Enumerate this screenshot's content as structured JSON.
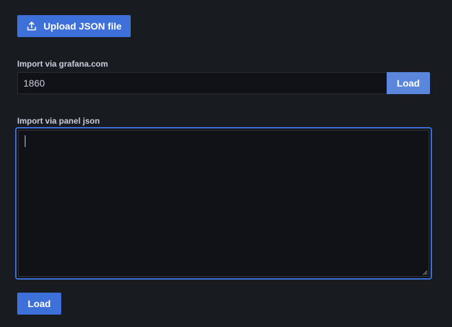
{
  "upload": {
    "label": "Upload JSON file",
    "icon": "upload-icon"
  },
  "grafana_com": {
    "label": "Import via grafana.com",
    "value": "1860",
    "load_label": "Load"
  },
  "panel_json": {
    "label": "Import via panel json",
    "value": "",
    "load_label": "Load"
  },
  "colors": {
    "background": "#181b1f",
    "primary": "#3d71d9",
    "primary_muted": "#5a86db",
    "input_bg": "#111217",
    "text": "#ccccdc"
  }
}
